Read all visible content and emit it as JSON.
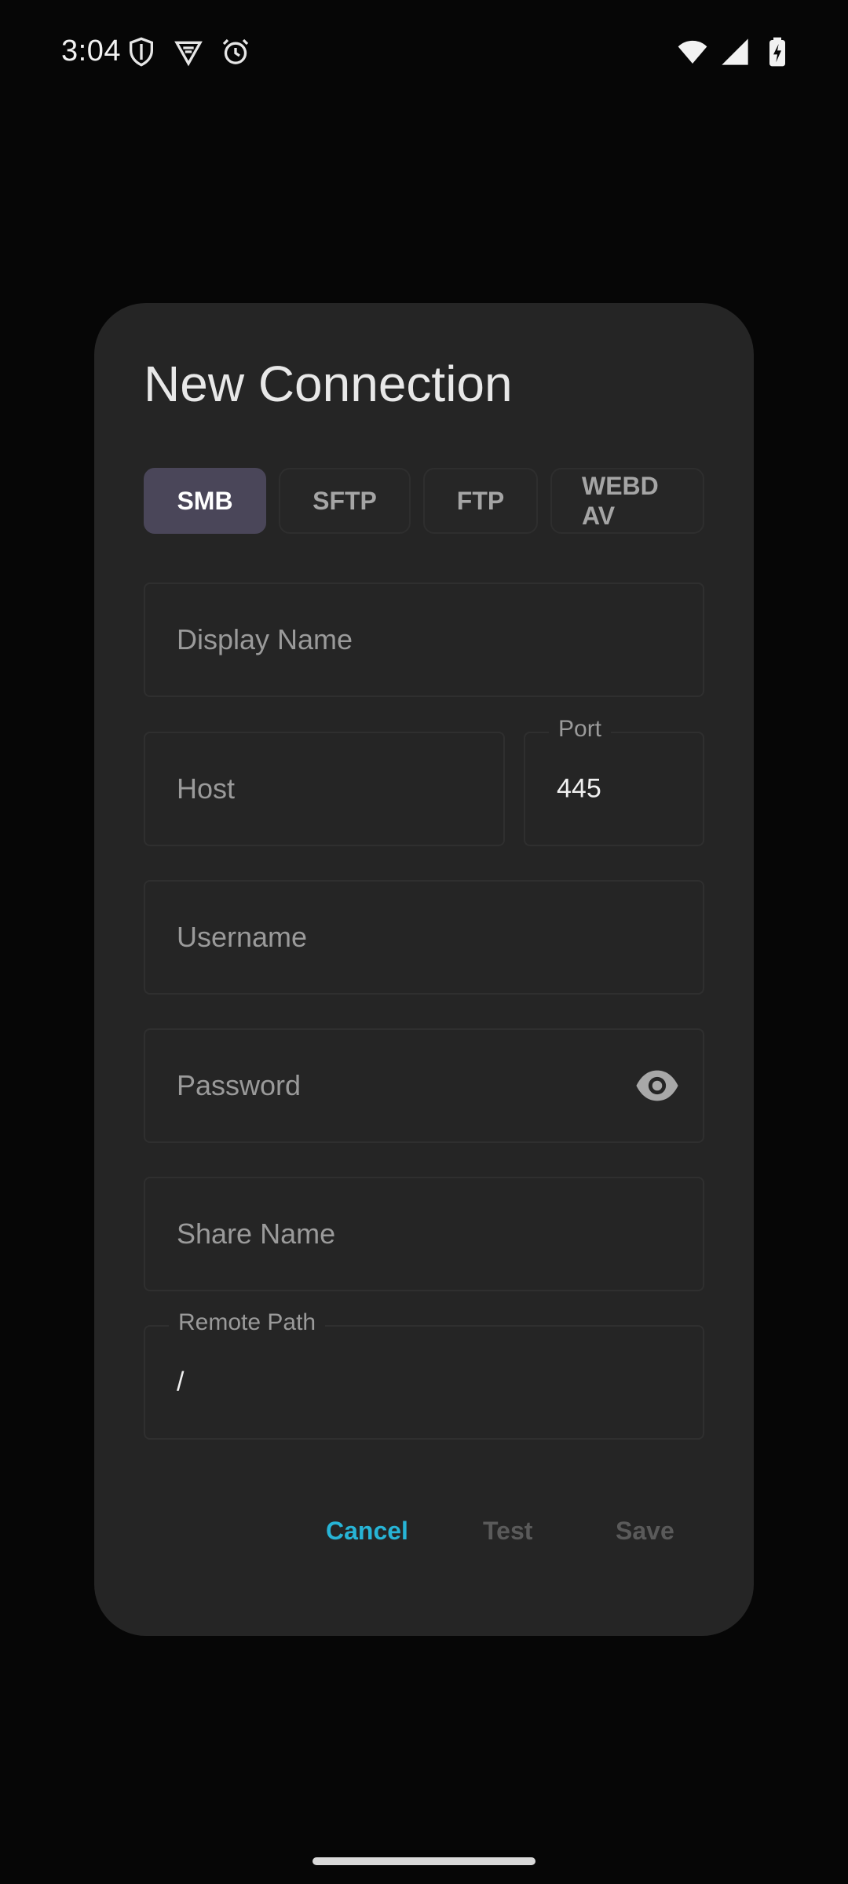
{
  "status_bar": {
    "time": "3:04",
    "icons_left": [
      "shield-icon",
      "vpn-icon",
      "alarm-icon"
    ],
    "icons_right": [
      "wifi-icon",
      "signal-icon",
      "battery-charging-icon"
    ]
  },
  "dialog": {
    "title": "New Connection",
    "protocol_tabs": [
      {
        "label": "SMB",
        "selected": true
      },
      {
        "label": "SFTP",
        "selected": false
      },
      {
        "label": "FTP",
        "selected": false
      },
      {
        "label": "WEBD AV",
        "selected": false
      }
    ],
    "fields": {
      "display_name": {
        "placeholder": "Display Name",
        "value": ""
      },
      "host": {
        "placeholder": "Host",
        "value": ""
      },
      "port": {
        "label": "Port",
        "value": "445"
      },
      "username": {
        "placeholder": "Username",
        "value": ""
      },
      "password": {
        "placeholder": "Password",
        "value": ""
      },
      "share_name": {
        "placeholder": "Share Name",
        "value": ""
      },
      "remote_path": {
        "label": "Remote Path",
        "value": "/"
      }
    },
    "actions": {
      "cancel": "Cancel",
      "test": "Test",
      "save": "Save"
    }
  },
  "colors": {
    "accent": "#27b4d6",
    "selected_tab": "#4a4659",
    "dialog_bg": "#252525",
    "screen_bg": "#060606"
  }
}
